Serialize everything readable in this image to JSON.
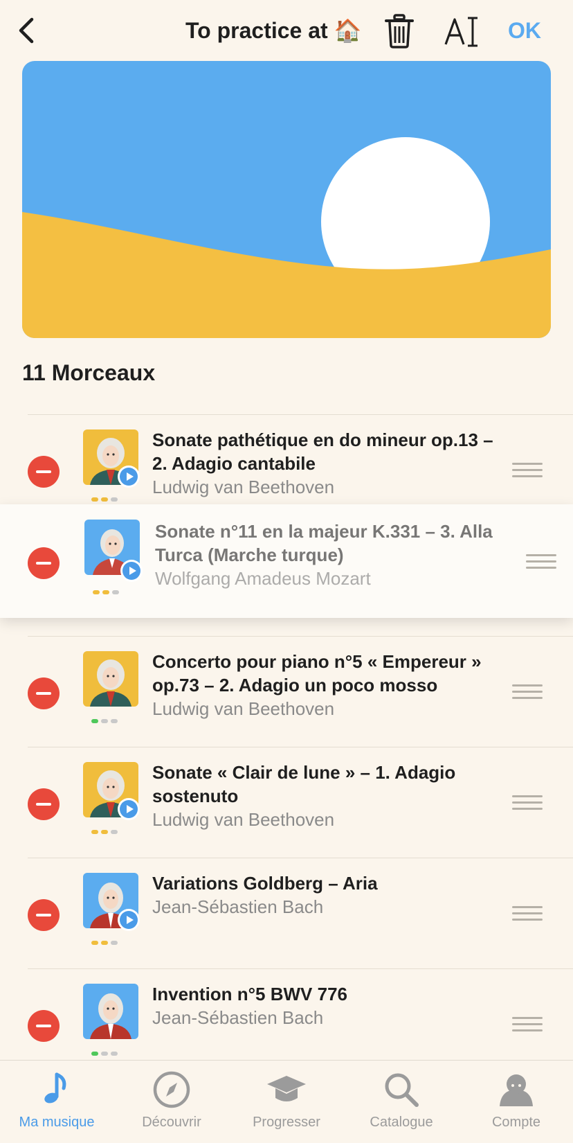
{
  "header": {
    "title": "To practice at 🏠",
    "ok_label": "OK"
  },
  "playlist": {
    "count_label": "11 Morceaux"
  },
  "pieces": [
    {
      "title": "Sonate pathétique en do mineur op.13 – 2. Adagio cantabile",
      "artist": "Ludwig van Beethoven",
      "composer_icon": "beethoven-portrait-icon",
      "has_audio": true,
      "difficulty": 2
    },
    {
      "title": "Sonate n°11 en la majeur K.331 – 3. Alla Turca (Marche turque)",
      "artist": "Wolfgang Amadeus Mozart",
      "composer_icon": "mozart-portrait-icon",
      "has_audio": true,
      "difficulty": 2,
      "dragging": true
    },
    {
      "title": "Concerto pour piano n°5 « Empereur » op.73 – 2. Adagio un poco mosso",
      "artist": "Ludwig van Beethoven",
      "composer_icon": "beethoven-portrait-icon",
      "has_audio": false,
      "difficulty": 1
    },
    {
      "title": "Sonate « Clair de lune » – 1. Adagio sostenuto",
      "artist": "Ludwig van Beethoven",
      "composer_icon": "beethoven-portrait-icon",
      "has_audio": true,
      "difficulty": 2
    },
    {
      "title": "Variations Goldberg – Aria",
      "artist": "Jean-Sébastien Bach",
      "composer_icon": "bach-portrait-icon",
      "has_audio": true,
      "difficulty": 2
    },
    {
      "title": "Invention n°5 BWV 776",
      "artist": "Jean-Sébastien Bach",
      "composer_icon": "bach-portrait-icon",
      "has_audio": false,
      "difficulty": 1
    }
  ],
  "tabs": [
    {
      "label": "Ma musique",
      "icon": "music-note-icon",
      "active": true
    },
    {
      "label": "Découvrir",
      "icon": "compass-icon",
      "active": false
    },
    {
      "label": "Progresser",
      "icon": "graduation-cap-icon",
      "active": false
    },
    {
      "label": "Catalogue",
      "icon": "search-icon",
      "active": false
    },
    {
      "label": "Compte",
      "icon": "account-icon",
      "active": false
    }
  ],
  "colors": {
    "background": "#FBF5EC",
    "accent": "#4A9BE8",
    "remove": "#E8493B",
    "cover_sky": "#5BACEF",
    "cover_sand": "#F4BF42",
    "difficulty_yellow": "#F0BD3C",
    "difficulty_green": "#4FC85B",
    "difficulty_empty": "#C9C9C9"
  }
}
